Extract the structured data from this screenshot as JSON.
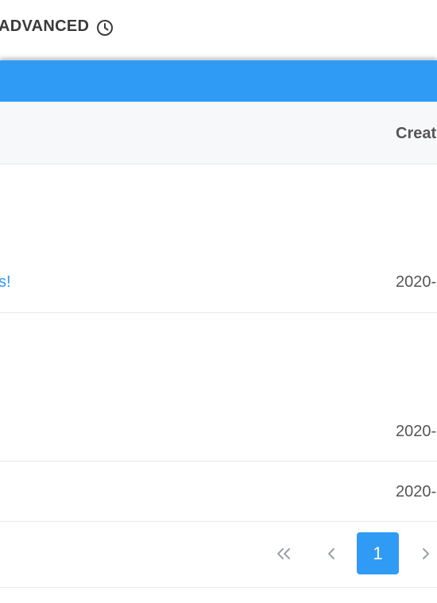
{
  "header": {
    "title": "ADVANCED",
    "history_icon": "clock-icon"
  },
  "table": {
    "columns": {
      "created": "Creat"
    },
    "rows": [
      {
        "title": "s!",
        "created": "2020-"
      },
      {
        "title": "",
        "created": "2020-"
      },
      {
        "title": "",
        "created": "2020-"
      }
    ]
  },
  "pagination": {
    "first_icon": "double-chevron-left-icon",
    "prev_icon": "chevron-left-icon",
    "current_page": "1",
    "next_icon": "chevron-right-icon"
  },
  "colors": {
    "accent": "#2f9bf5",
    "header_bg": "#f7f8fa"
  }
}
